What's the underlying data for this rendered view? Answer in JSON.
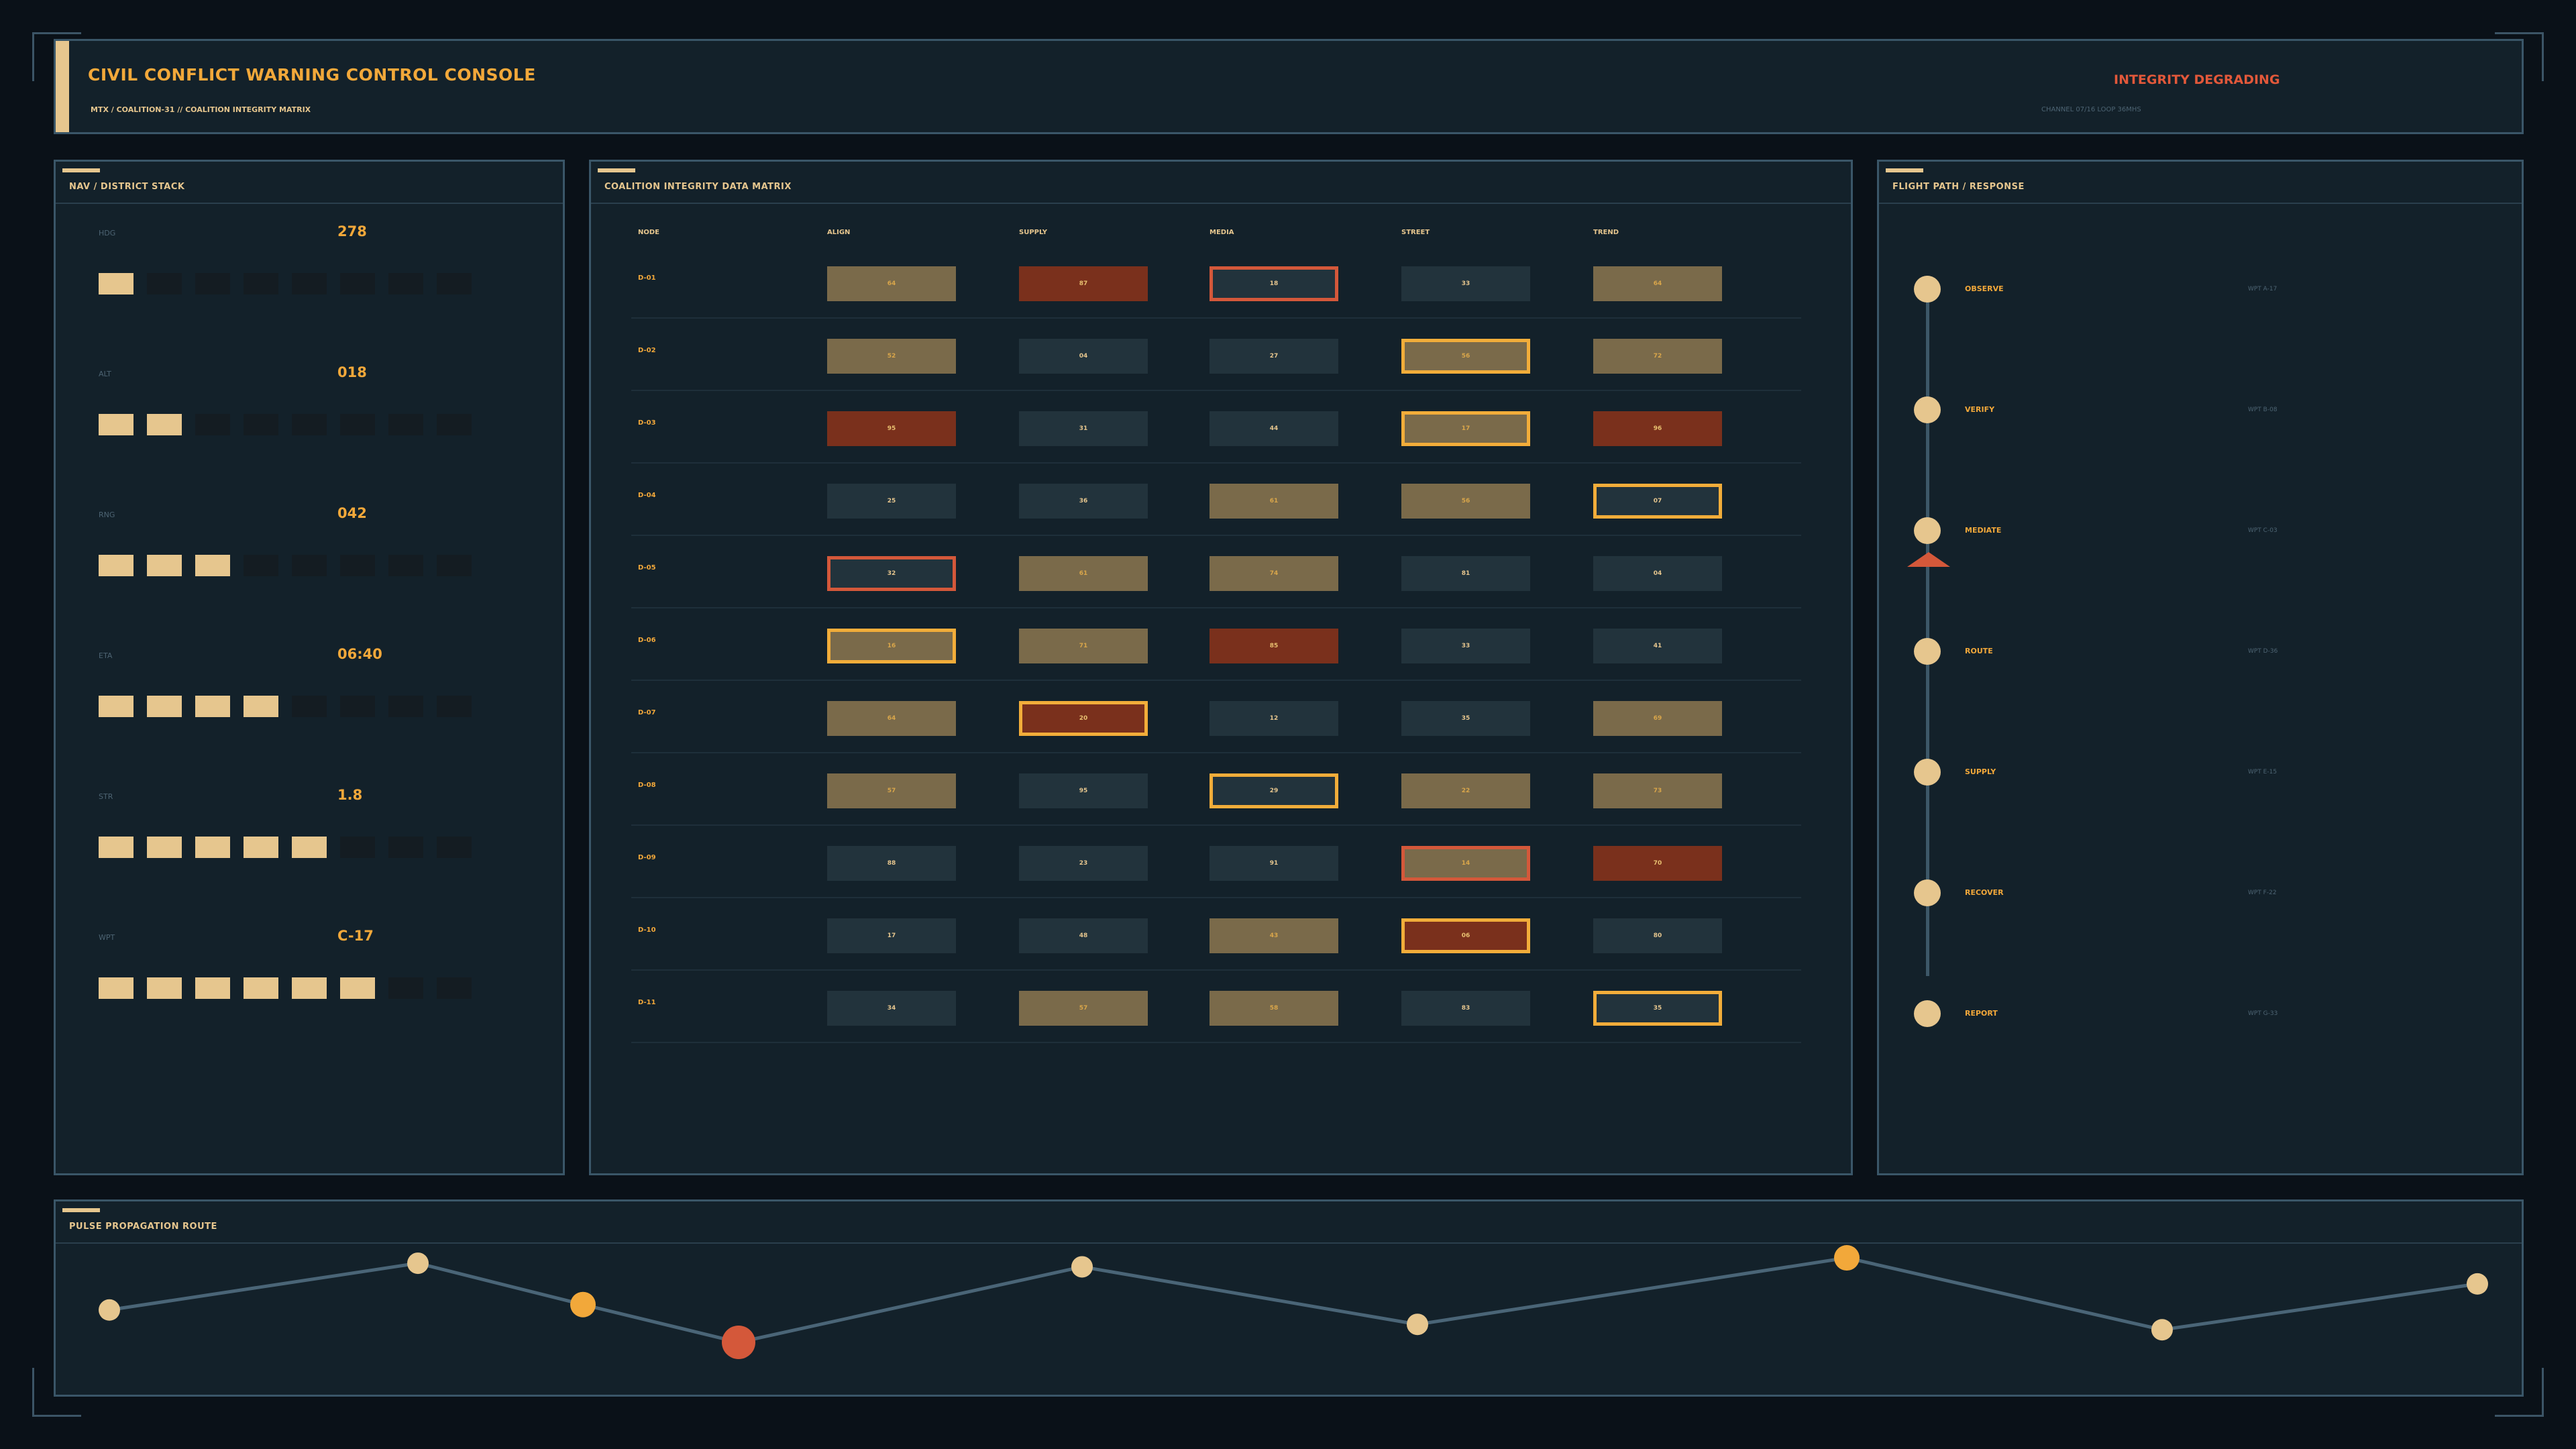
{
  "header": {
    "title": "CIVIL CONFLICT WARNING CONTROL CONSOLE",
    "subtitle": "MTX / COALITION-31 // COALITION INTEGRITY MATRIX",
    "status": "INTEGRITY DEGRADING",
    "status_color": "#e2583a",
    "channel": "CHANNEL 07/16 LOOP 36MHS"
  },
  "nav": {
    "title": "NAV / DISTRICT STACK",
    "rows": [
      {
        "label": "HDG",
        "value": "278",
        "level": 1
      },
      {
        "label": "ALT",
        "value": "018",
        "level": 2
      },
      {
        "label": "RNG",
        "value": "042",
        "level": 3
      },
      {
        "label": "ETA",
        "value": "06:40",
        "level": 4
      },
      {
        "label": "STR",
        "value": "1.8",
        "level": 5
      },
      {
        "label": "WPT",
        "value": "C-17",
        "level": 6
      }
    ],
    "block_count": 8
  },
  "matrix": {
    "title": "COALITION INTEGRITY DATA MATRIX",
    "columns": [
      "NODE",
      "ALIGN",
      "SUPPLY",
      "MEDIA",
      "STREET",
      "TREND"
    ],
    "rows": [
      {
        "id": "D-01",
        "cells": [
          {
            "v": "64",
            "t": "w"
          },
          {
            "v": "87",
            "t": "h"
          },
          {
            "v": "18",
            "t": "n",
            "b": "r"
          },
          {
            "v": "33",
            "t": "n"
          },
          {
            "v": "64",
            "t": "w"
          }
        ]
      },
      {
        "id": "D-02",
        "cells": [
          {
            "v": "52",
            "t": "w"
          },
          {
            "v": "04",
            "t": "n"
          },
          {
            "v": "27",
            "t": "n"
          },
          {
            "v": "56",
            "t": "w",
            "b": "a"
          },
          {
            "v": "72",
            "t": "w"
          }
        ]
      },
      {
        "id": "D-03",
        "cells": [
          {
            "v": "95",
            "t": "h"
          },
          {
            "v": "31",
            "t": "n"
          },
          {
            "v": "44",
            "t": "n"
          },
          {
            "v": "17",
            "t": "w",
            "b": "a"
          },
          {
            "v": "96",
            "t": "h"
          }
        ]
      },
      {
        "id": "D-04",
        "cells": [
          {
            "v": "25",
            "t": "n"
          },
          {
            "v": "36",
            "t": "n"
          },
          {
            "v": "61",
            "t": "w"
          },
          {
            "v": "56",
            "t": "w"
          },
          {
            "v": "07",
            "t": "n",
            "b": "a"
          }
        ]
      },
      {
        "id": "D-05",
        "cells": [
          {
            "v": "32",
            "t": "n",
            "b": "r"
          },
          {
            "v": "61",
            "t": "w"
          },
          {
            "v": "74",
            "t": "w"
          },
          {
            "v": "81",
            "t": "n"
          },
          {
            "v": "04",
            "t": "n"
          }
        ]
      },
      {
        "id": "D-06",
        "cells": [
          {
            "v": "16",
            "t": "w",
            "b": "a"
          },
          {
            "v": "71",
            "t": "w"
          },
          {
            "v": "85",
            "t": "h"
          },
          {
            "v": "33",
            "t": "n"
          },
          {
            "v": "41",
            "t": "n"
          }
        ]
      },
      {
        "id": "D-07",
        "cells": [
          {
            "v": "64",
            "t": "w"
          },
          {
            "v": "20",
            "t": "h",
            "b": "a"
          },
          {
            "v": "12",
            "t": "n"
          },
          {
            "v": "35",
            "t": "n"
          },
          {
            "v": "69",
            "t": "w"
          }
        ]
      },
      {
        "id": "D-08",
        "cells": [
          {
            "v": "57",
            "t": "w"
          },
          {
            "v": "95",
            "t": "n"
          },
          {
            "v": "29",
            "t": "n",
            "b": "a"
          },
          {
            "v": "22",
            "t": "w"
          },
          {
            "v": "73",
            "t": "w"
          }
        ]
      },
      {
        "id": "D-09",
        "cells": [
          {
            "v": "88",
            "t": "n"
          },
          {
            "v": "23",
            "t": "n"
          },
          {
            "v": "91",
            "t": "n"
          },
          {
            "v": "14",
            "t": "w",
            "b": "r"
          },
          {
            "v": "70",
            "t": "h"
          }
        ]
      },
      {
        "id": "D-10",
        "cells": [
          {
            "v": "17",
            "t": "n"
          },
          {
            "v": "48",
            "t": "n"
          },
          {
            "v": "43",
            "t": "w"
          },
          {
            "v": "06",
            "t": "h",
            "b": "a"
          },
          {
            "v": "80",
            "t": "n"
          }
        ]
      },
      {
        "id": "D-11",
        "cells": [
          {
            "v": "34",
            "t": "n"
          },
          {
            "v": "57",
            "t": "w"
          },
          {
            "v": "58",
            "t": "w"
          },
          {
            "v": "83",
            "t": "n"
          },
          {
            "v": "35",
            "t": "n",
            "b": "a"
          }
        ]
      }
    ]
  },
  "flight": {
    "title": "FLIGHT PATH / RESPONSE",
    "steps": [
      {
        "label": "OBSERVE",
        "wp": "WPT A-17"
      },
      {
        "label": "VERIFY",
        "wp": "WPT B-08"
      },
      {
        "label": "MEDIATE",
        "wp": "WPT C-03"
      },
      {
        "label": "ROUTE",
        "wp": "WPT D-36"
      },
      {
        "label": "SUPPLY",
        "wp": "WPT E-15"
      },
      {
        "label": "RECOVER",
        "wp": "WPT F-22"
      },
      {
        "label": "REPORT",
        "wp": "WPT G-33"
      }
    ],
    "marker_color": "#d4583a"
  },
  "pulse": {
    "title": "PULSE PROPAGATION ROUTE",
    "points": [
      {
        "level": 0.36,
        "state": "normal"
      },
      {
        "level": 0.88,
        "state": "normal"
      },
      {
        "level": 0.42,
        "state": "warn"
      },
      {
        "level": 0.0,
        "state": "alert"
      },
      {
        "level": 0.84,
        "state": "normal"
      },
      {
        "level": 0.2,
        "state": "normal"
      },
      {
        "level": 0.94,
        "state": "warn"
      },
      {
        "level": 0.14,
        "state": "normal"
      },
      {
        "level": 0.65,
        "state": "normal"
      }
    ]
  },
  "colors": {
    "accent": "#e6c68e",
    "warn": "#f2a83a",
    "alert": "#d4583a",
    "line": "#4a6577"
  }
}
